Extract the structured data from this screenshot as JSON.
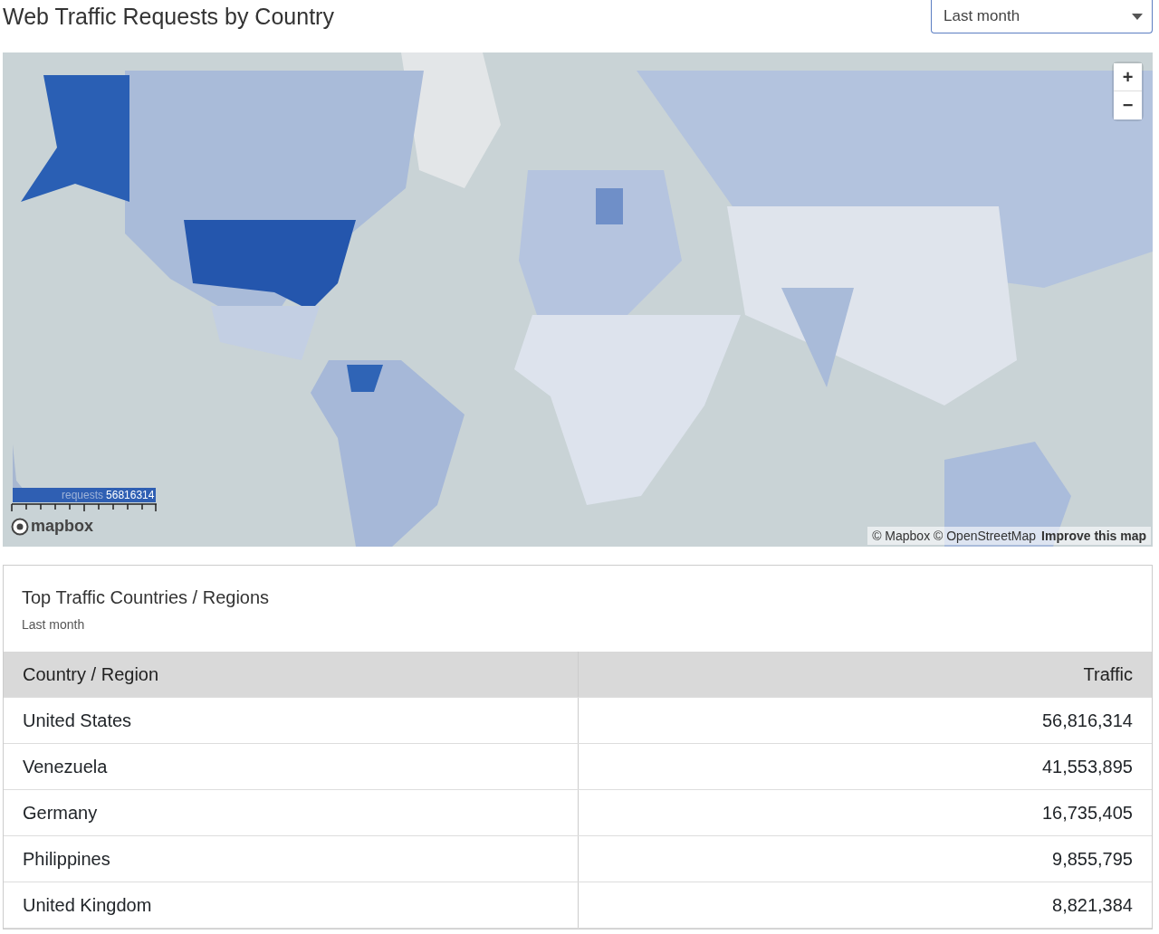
{
  "header": {
    "title": "Web Traffic Requests by Country",
    "period_select": {
      "value": "Last month"
    }
  },
  "map": {
    "kind": "picture",
    "zoom_in": "+",
    "zoom_out": "−",
    "legend": {
      "label": "requests",
      "max": "56816314"
    },
    "logo_text": "mapbox",
    "attribution": "© Mapbox © OpenStreetMap",
    "improve_link": "Improve this map"
  },
  "card": {
    "title": "Top Traffic Countries / Regions",
    "subtitle": "Last month",
    "table": {
      "columns": [
        "Country / Region",
        "Traffic"
      ],
      "rows": [
        [
          "United States",
          "56,816,314"
        ],
        [
          "Venezuela",
          "41,553,895"
        ],
        [
          "Germany",
          "16,735,405"
        ],
        [
          "Philippines",
          "9,855,795"
        ],
        [
          "United Kingdom",
          "8,821,384"
        ]
      ]
    }
  }
}
